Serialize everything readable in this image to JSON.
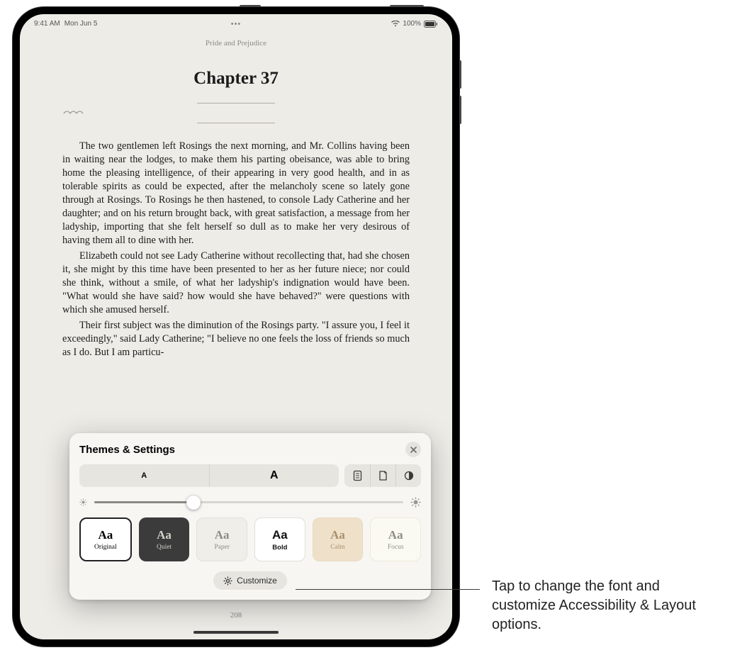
{
  "statusBar": {
    "time": "9:41 AM",
    "date": "Mon Jun 5",
    "batteryLabel": "100%"
  },
  "book": {
    "title": "Pride and Prejudice",
    "chapter": "Chapter 37",
    "p1": "The two gentlemen left Rosings the next morning, and Mr. Collins having been in waiting near the lodges, to make them his parting obeisance, was able to bring home the pleasing intelligence, of their appearing in very good health, and in as tolerable spirits as could be expected, after the melancholy scene so lately gone through at Rosings. To Rosings he then hastened, to console Lady Catherine and her daughter; and on his return brought back, with great satisfaction, a message from her ladyship, importing that she felt herself so dull as to make her very desirous of having them all to dine with her.",
    "p2": "Elizabeth could not see Lady Catherine without recollecting that, had she chosen it, she might by this time have been presented to her as her future niece; nor could she think, without a smile, of what her ladyship's indignation would have been. \"What would she have said? how would she have behaved?\" were questions with which she amused herself.",
    "p3": "Their first subject was the diminution of the Rosings party. \"I assure you, I feel it exceedingly,\" said Lady Catherine; \"I believe no one feels the loss of friends so much as I do. But I am particu-",
    "pageNumber": "208"
  },
  "panel": {
    "title": "Themes & Settings",
    "smallA": "A",
    "bigA": "A",
    "themes": {
      "original": "Original",
      "quiet": "Quiet",
      "paper": "Paper",
      "bold": "Bold",
      "calm": "Calm",
      "focus": "Focus"
    },
    "customize": "Customize",
    "brightnessPercent": 32
  },
  "callout": {
    "text": "Tap to change the font and customize Accessibility & Layout options."
  }
}
